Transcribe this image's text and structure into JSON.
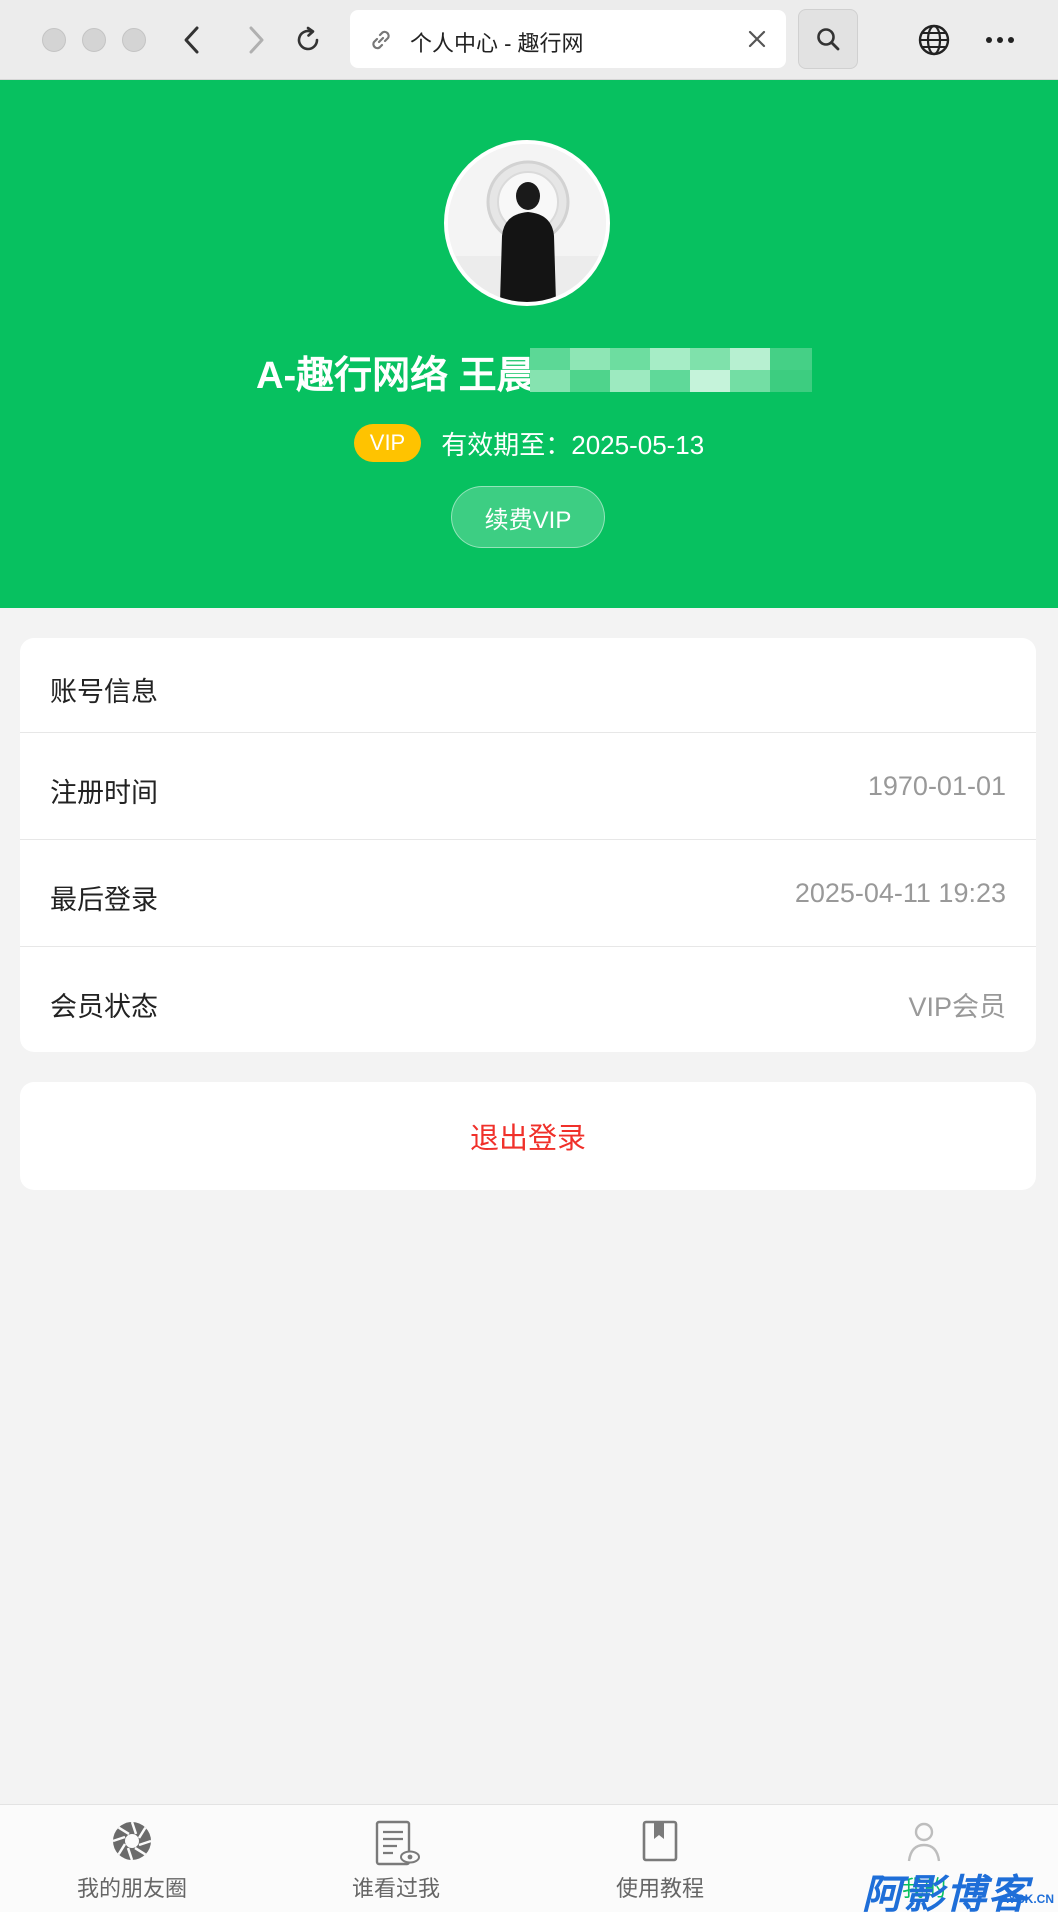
{
  "browser": {
    "tab_title": "个人中心 - 趣行网",
    "icons": [
      "back-icon",
      "forward-icon",
      "reload-icon",
      "link-icon",
      "close-icon",
      "search-icon",
      "globe-icon",
      "more-icon"
    ]
  },
  "profile": {
    "username": "A-趣行网络 王晨",
    "vip_badge": "VIP",
    "expire_text": "有效期至：2025-05-13",
    "renew_label": "续费VIP"
  },
  "account": {
    "title": "账号信息",
    "rows": [
      {
        "label": "注册时间",
        "value": "1970-01-01"
      },
      {
        "label": "最后登录",
        "value": "2025-04-11 19:23"
      },
      {
        "label": "会员状态",
        "value": "VIP会员"
      }
    ]
  },
  "logout_label": "退出登录",
  "tabbar": [
    {
      "label": "我的朋友圈",
      "icon": "aperture-icon"
    },
    {
      "label": "谁看过我",
      "icon": "viewed-doc-icon"
    },
    {
      "label": "使用教程",
      "icon": "bookmark-icon"
    },
    {
      "label": "我的",
      "icon": "user-icon"
    }
  ],
  "watermark": {
    "text": "阿影博客",
    "sub": "AYBK.CN"
  },
  "colors": {
    "brand_green": "#07c160",
    "vip_yellow": "#ffc300",
    "logout_red": "#f0302a"
  }
}
